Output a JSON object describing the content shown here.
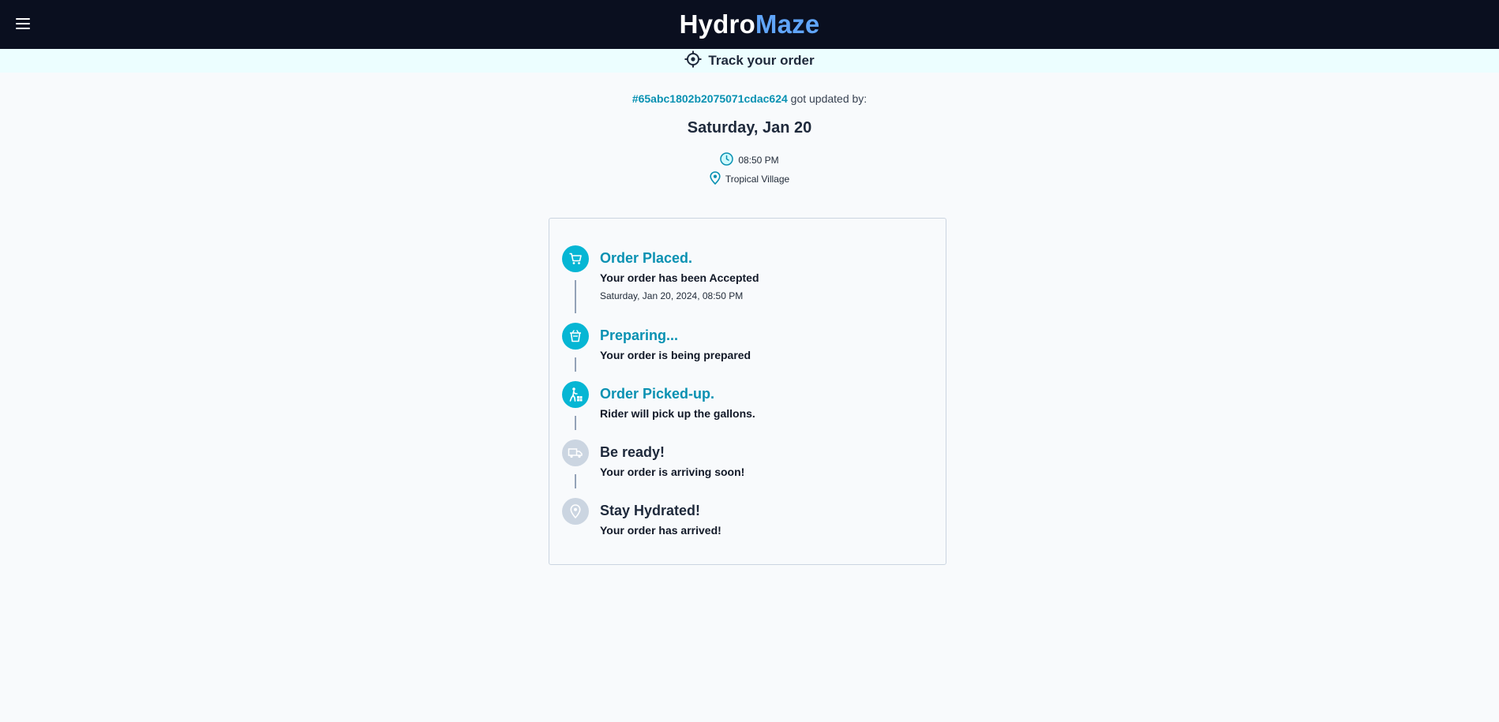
{
  "header": {
    "brand_part1": "Hydro",
    "brand_part2": "Maze",
    "menu_icon": "hamburger-menu-icon"
  },
  "tracking": {
    "label": "Track your order",
    "icon": "crosshair-icon"
  },
  "update": {
    "order_id": "#65abc1802b2075071cdac624",
    "suffix": "got updated by:",
    "date": "Saturday, Jan 20",
    "time": "08:50 PM",
    "location": "Tropical Village"
  },
  "steps": [
    {
      "title": "Order Placed.",
      "desc": "Your order has been Accepted",
      "timestamp": "Saturday, Jan 20, 2024, 08:50 PM",
      "icon": "cart-icon",
      "active": true
    },
    {
      "title": "Preparing...",
      "desc": "Your order is being prepared",
      "timestamp": "",
      "icon": "basket-icon",
      "active": true
    },
    {
      "title": "Order Picked-up.",
      "desc": "Rider will pick up the gallons.",
      "timestamp": "",
      "icon": "person-carry-icon",
      "active": true
    },
    {
      "title": "Be ready!",
      "desc": "Your order is arriving soon!",
      "timestamp": "",
      "icon": "truck-icon",
      "active": false
    },
    {
      "title": "Stay Hydrated!",
      "desc": "Your order has arrived!",
      "timestamp": "",
      "icon": "location-pin-icon",
      "active": false
    }
  ],
  "colors": {
    "accent": "#06b6d4",
    "accent_text": "#0891b2",
    "inactive": "#cbd5e1",
    "header_bg": "#0a0f1f",
    "brand_blue": "#60a5fa"
  }
}
